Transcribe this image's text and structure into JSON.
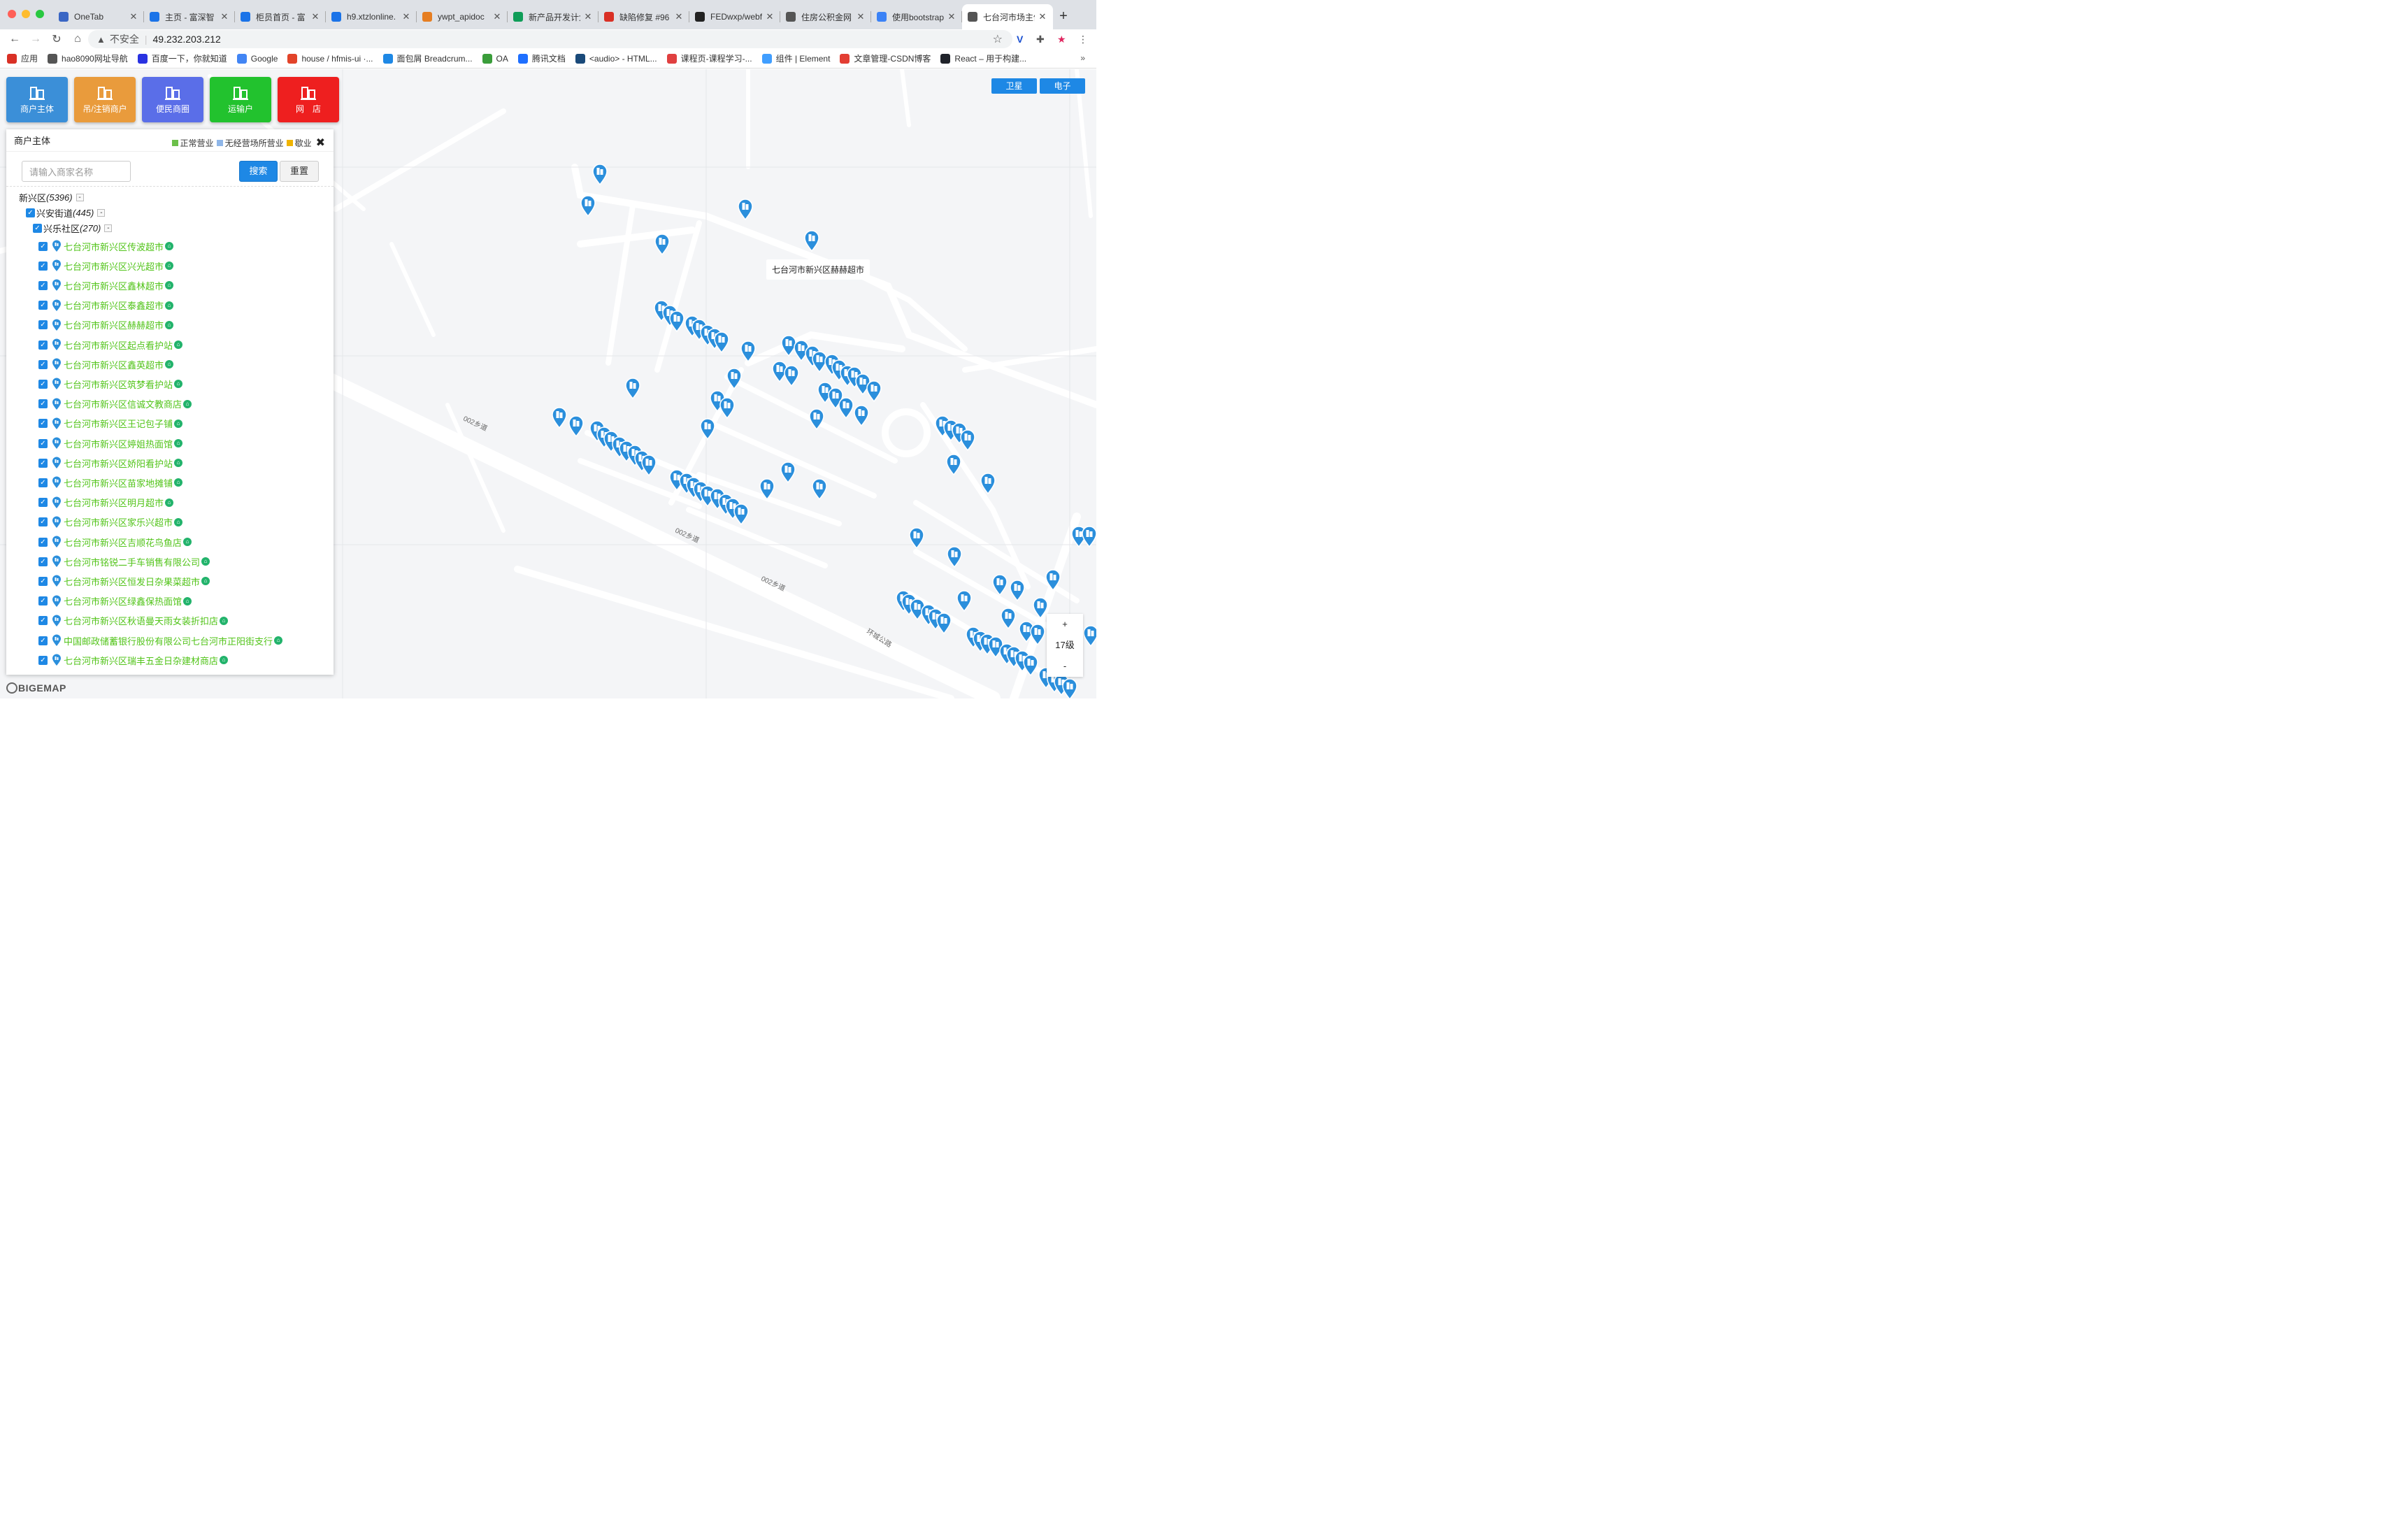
{
  "browser": {
    "tabs": [
      {
        "title": "OneTab",
        "color": "#3a66c4"
      },
      {
        "title": "主页 - 富深智",
        "color": "#1a73e8"
      },
      {
        "title": "柜员首页 - 富",
        "color": "#1a73e8"
      },
      {
        "title": "h9.xtzlonline.",
        "color": "#1a73e8"
      },
      {
        "title": "ywpt_apidoc",
        "color": "#e67e22"
      },
      {
        "title": "新产品开发计划",
        "color": "#0f9d58"
      },
      {
        "title": "缺陷修复 #96",
        "color": "#d93025"
      },
      {
        "title": "FEDwxp/webf",
        "color": "#222222"
      },
      {
        "title": "住房公积金网",
        "color": "#555555"
      },
      {
        "title": "使用bootstrap",
        "color": "#3b82f6"
      },
      {
        "title": "七台河市场主体",
        "color": "#555555"
      }
    ],
    "active_tab": 10,
    "address": {
      "insecure_label": "不安全",
      "url": "49.232.203.212"
    },
    "bookmarks": [
      {
        "label": "应用",
        "color": "#d93025"
      },
      {
        "label": "hao8090网址导航",
        "color": "#555555"
      },
      {
        "label": "百度一下，你就知道",
        "color": "#2932e1"
      },
      {
        "label": "Google",
        "color": "#4285f4"
      },
      {
        "label": "house / hfmis-ui ·...",
        "color": "#e24329"
      },
      {
        "label": "面包屑 Breadcrum...",
        "color": "#1e88e5"
      },
      {
        "label": "OA",
        "color": "#3a9d3a"
      },
      {
        "label": "腾讯文档",
        "color": "#1e6fff"
      },
      {
        "label": "<audio> - HTML...",
        "color": "#1a4a7a"
      },
      {
        "label": "课程页-课程学习-...",
        "color": "#e04040"
      },
      {
        "label": "组件 | Element",
        "color": "#409eff"
      },
      {
        "label": "文章管理-CSDN博客",
        "color": "#e33e33"
      },
      {
        "label": "React – 用于构建...",
        "color": "#20232a"
      }
    ],
    "more": "»"
  },
  "categories": [
    {
      "label": "商户主体",
      "color": "#3b8fd8"
    },
    {
      "label": "吊/注销商户",
      "color": "#e99b3c"
    },
    {
      "label": "便民商圈",
      "color": "#5a6ee8"
    },
    {
      "label": "运输户",
      "color": "#22c22e"
    },
    {
      "label": "网　店",
      "color": "#ee1f1f"
    }
  ],
  "map_type": {
    "satellite": "卫星",
    "electronic": "电子"
  },
  "panel": {
    "title": "商户主体",
    "legend": [
      {
        "label": "正常营业",
        "color": "#6cc04a"
      },
      {
        "label": "无经营场所营业",
        "color": "#8fb6e8"
      },
      {
        "label": "歇业",
        "color": "#f0b400"
      }
    ],
    "search_placeholder": "请输入商家名称",
    "search_button": "搜索",
    "reset_button": "重置",
    "tree": {
      "district": {
        "name": "新兴区",
        "count": "(5396)"
      },
      "street": {
        "name": "兴安街道",
        "count": "(445)"
      },
      "community": {
        "name": "兴乐社区",
        "count": "(270)"
      },
      "toggle": "-",
      "merchants": [
        "七台河市新兴区传波超市",
        "七台河市新兴区兴光超市",
        "七台河市新兴区鑫林超市",
        "七台河市新兴区泰鑫超市",
        "七台河市新兴区赫赫超市",
        "七台河市新兴区起点看护站",
        "七台河市新兴区鑫英超市",
        "七台河市新兴区筑梦看护站",
        "七台河市新兴区信诚文教商店",
        "七台河市新兴区王记包子铺",
        "七台河市新兴区婷姐热面馆",
        "七台河市新兴区娇阳看护站",
        "七台河市新兴区苗家地摊铺",
        "七台河市新兴区明月超市",
        "七台河市新兴区家乐兴超市",
        "七台河市新兴区吉顺花鸟鱼店",
        "七台河市铭锐二手车销售有限公司",
        "七台河市新兴区恒发日杂果菜超市",
        "七台河市新兴区绿鑫保热面馆",
        "七台河市新兴区秋语曼天雨女装折扣店",
        "中国邮政储蓄银行股份有限公司七台河市正阳街支行",
        "七台河市新兴区瑞丰五金日杂建材商店"
      ]
    }
  },
  "map": {
    "label": "七台河市新兴区赫赫超市",
    "road_labels": [
      "002乡道",
      "002乡道",
      "002乡道",
      "环城公路"
    ],
    "zoom": {
      "in": "+",
      "level": "17级",
      "out": "-"
    },
    "logo": "BIGEMAP",
    "marker_color": "#2b8fdc"
  }
}
